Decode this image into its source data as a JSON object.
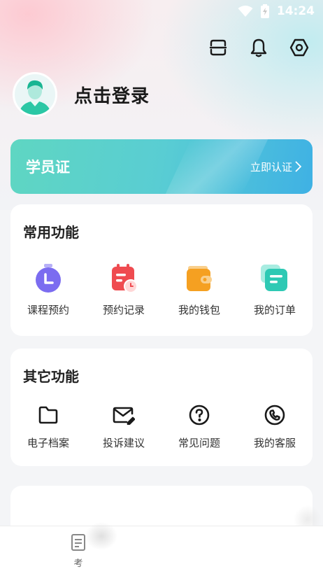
{
  "status_bar": {
    "time": "14:24",
    "icons": [
      "wifi-icon",
      "battery-charging-icon"
    ]
  },
  "header": {
    "actions": [
      {
        "name": "scan-icon"
      },
      {
        "name": "bell-icon"
      },
      {
        "name": "settings-icon"
      }
    ]
  },
  "profile": {
    "login_label": "点击登录"
  },
  "student_card": {
    "title": "学员证",
    "action": "立即认证"
  },
  "common_functions": {
    "title": "常用功能",
    "items": [
      {
        "label": "课程预约",
        "icon": "clock-icon",
        "color": "#7b6cf0"
      },
      {
        "label": "预约记录",
        "icon": "calendar-record-icon",
        "color": "#ef4b50"
      },
      {
        "label": "我的钱包",
        "icon": "wallet-icon",
        "color": "#f5a021"
      },
      {
        "label": "我的订单",
        "icon": "order-icon",
        "color": "#2ec9b4"
      }
    ]
  },
  "other_functions": {
    "title": "其它功能",
    "items": [
      {
        "label": "电子档案",
        "icon": "folder-icon"
      },
      {
        "label": "投诉建议",
        "icon": "mail-edit-icon"
      },
      {
        "label": "常见问题",
        "icon": "question-icon"
      },
      {
        "label": "我的客服",
        "icon": "phone-icon"
      }
    ]
  },
  "tabbar": {
    "tabs": [
      {
        "label": "考",
        "icon": "document-icon"
      }
    ]
  }
}
